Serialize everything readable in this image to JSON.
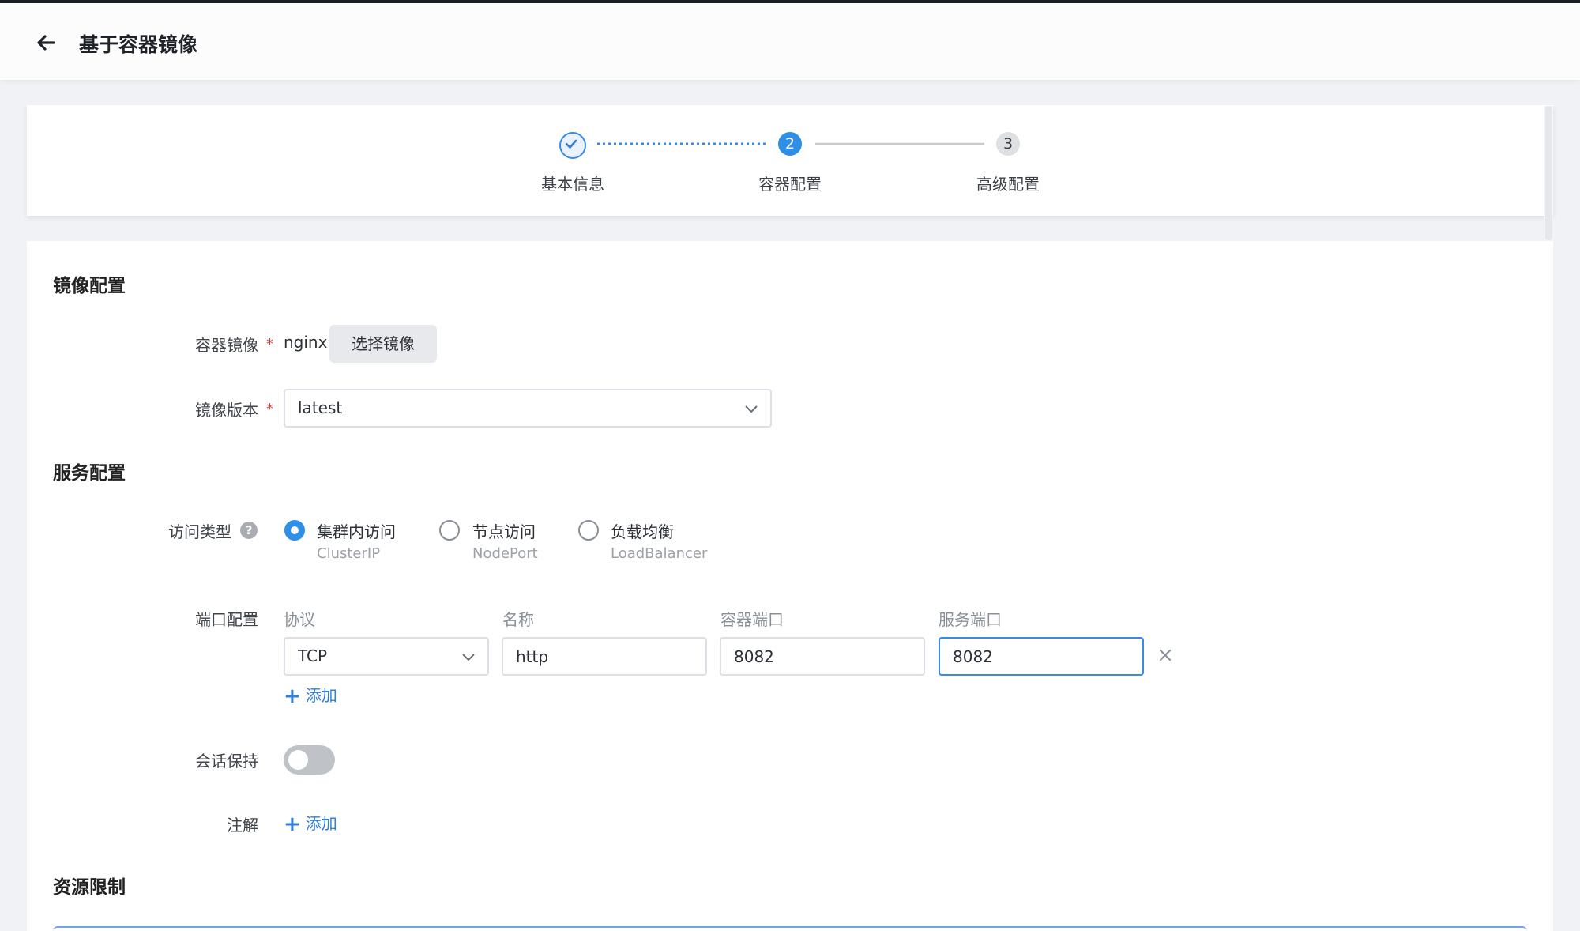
{
  "header": {
    "title": "基于容器镜像"
  },
  "steps": [
    {
      "label": "基本信息",
      "status": "done"
    },
    {
      "number": "2",
      "label": "容器配置",
      "status": "active"
    },
    {
      "number": "3",
      "label": "高级配置",
      "status": "pending"
    }
  ],
  "image_config": {
    "title": "镜像配置",
    "container_image_label": "容器镜像",
    "container_image_value": "nginx",
    "select_image_button": "选择镜像",
    "image_version_label": "镜像版本",
    "image_version_value": "latest"
  },
  "service_config": {
    "title": "服务配置",
    "access_type_label": "访问类型",
    "access_types": [
      {
        "label": "集群内访问",
        "sub": "ClusterIP",
        "selected": true
      },
      {
        "label": "节点访问",
        "sub": "NodePort",
        "selected": false
      },
      {
        "label": "负载均衡",
        "sub": "LoadBalancer",
        "selected": false
      }
    ],
    "port_config_label": "端口配置",
    "port_columns": [
      "协议",
      "名称",
      "容器端口",
      "服务端口"
    ],
    "port_row": {
      "protocol": "TCP",
      "name": "http",
      "container_port": "8082",
      "service_port": "8082"
    },
    "add_label": "添加",
    "session_label": "会话保持",
    "session_enabled": false,
    "annotation_label": "注解",
    "annotation_add_label": "添加"
  },
  "resource_limits": {
    "title": "资源限制"
  },
  "colors": {
    "accent": "#2f8ee5",
    "required": "#e53935",
    "link": "#2f7fd8"
  }
}
